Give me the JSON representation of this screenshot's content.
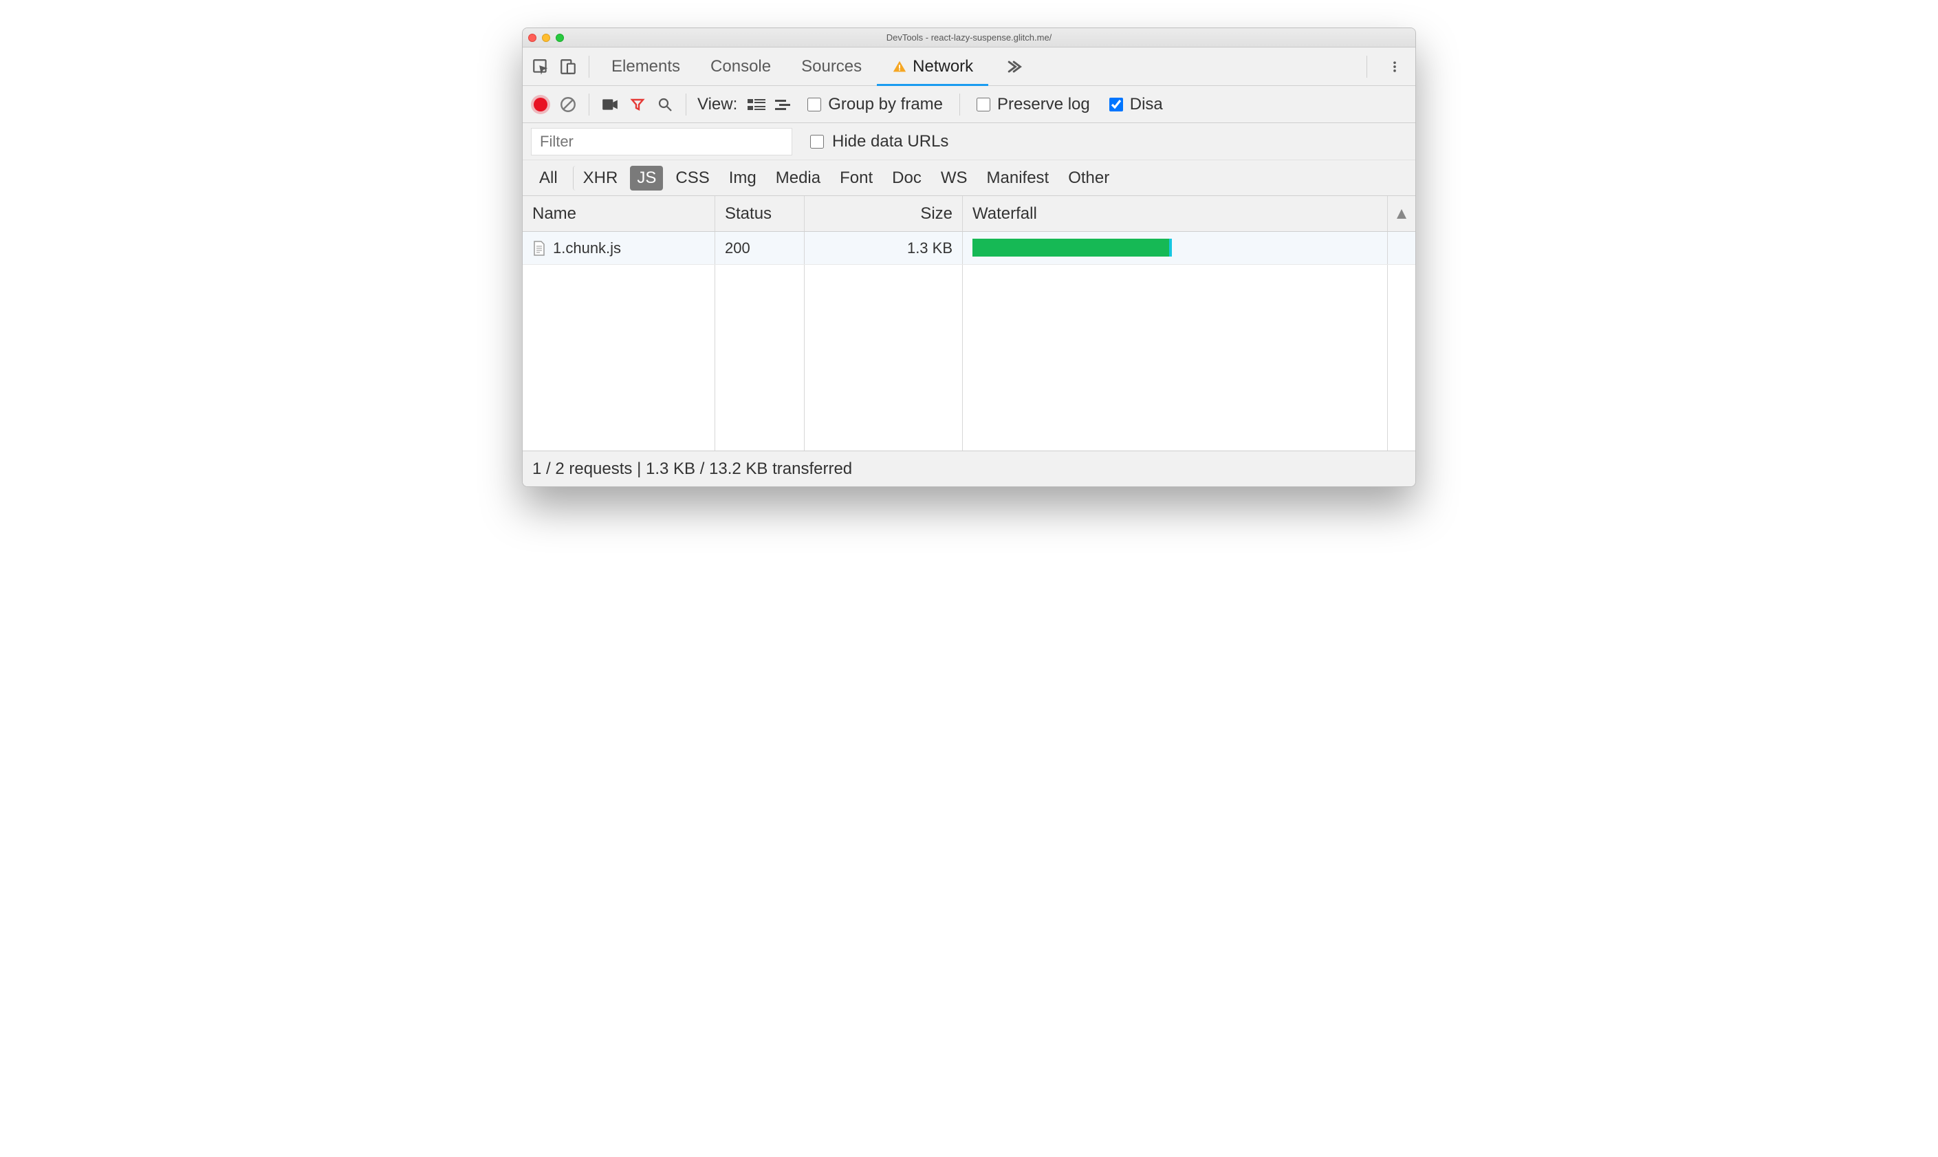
{
  "window": {
    "title": "DevTools - react-lazy-suspense.glitch.me/"
  },
  "tabs": {
    "items": [
      "Elements",
      "Console",
      "Sources",
      "Network"
    ],
    "active_index": 3,
    "active_has_warning": true
  },
  "toolbar": {
    "view_label": "View:",
    "group_by_frame": {
      "label": "Group by frame",
      "checked": false
    },
    "preserve_log": {
      "label": "Preserve log",
      "checked": false
    },
    "disable_cache": {
      "label": "Disa",
      "checked": true
    }
  },
  "filter": {
    "placeholder": "Filter",
    "hide_data_urls": {
      "label": "Hide data URLs",
      "checked": false
    }
  },
  "type_filters": {
    "items": [
      "All",
      "XHR",
      "JS",
      "CSS",
      "Img",
      "Media",
      "Font",
      "Doc",
      "WS",
      "Manifest",
      "Other"
    ],
    "selected_index": 2
  },
  "table": {
    "columns": {
      "name": "Name",
      "status": "Status",
      "size": "Size",
      "waterfall": "Waterfall"
    },
    "rows": [
      {
        "name": "1.chunk.js",
        "status": "200",
        "size": "1.3 KB",
        "waterfall_pct": 48
      }
    ]
  },
  "status": {
    "summary": "1 / 2 requests | 1.3 KB / 13.2 KB transferred"
  }
}
